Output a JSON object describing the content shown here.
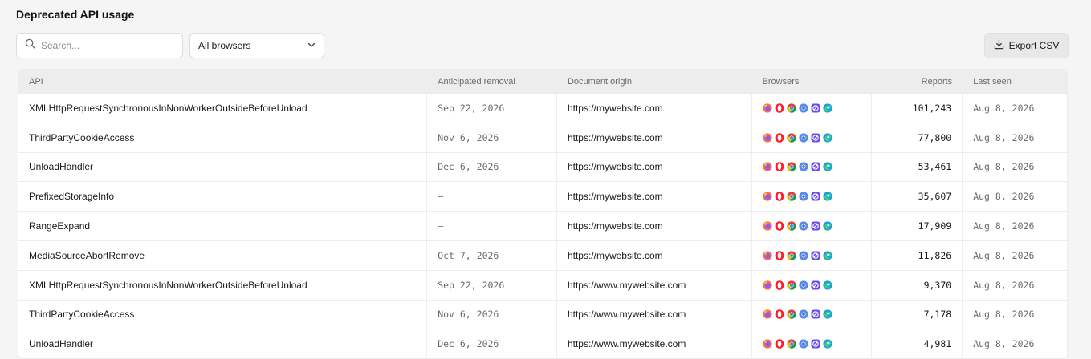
{
  "page": {
    "title": "Deprecated API usage"
  },
  "toolbar": {
    "search_placeholder": "Search...",
    "browser_filter": "All browsers",
    "export_label": "Export CSV"
  },
  "table": {
    "headers": {
      "api": "API",
      "removal": "Anticipated removal",
      "origin": "Document origin",
      "browsers": "Browsers",
      "reports": "Reports",
      "last_seen": "Last seen"
    },
    "browser_icons": [
      "firefox-icon",
      "opera-icon",
      "chrome-icon",
      "chromium-icon",
      "brave-icon",
      "edge-icon"
    ],
    "rows": [
      {
        "api": "XMLHttpRequestSynchronousInNonWorkerOutsideBeforeUnload",
        "removal": "Sep 22, 2026",
        "origin": "https://mywebsite.com",
        "reports": "101,243",
        "last_seen": "Aug 8, 2026"
      },
      {
        "api": "ThirdPartyCookieAccess",
        "removal": "Nov 6, 2026",
        "origin": "https://mywebsite.com",
        "reports": "77,800",
        "last_seen": "Aug 8, 2026"
      },
      {
        "api": "UnloadHandler",
        "removal": "Dec 6, 2026",
        "origin": "https://mywebsite.com",
        "reports": "53,461",
        "last_seen": "Aug 8, 2026"
      },
      {
        "api": "PrefixedStorageInfo",
        "removal": "—",
        "origin": "https://mywebsite.com",
        "reports": "35,607",
        "last_seen": "Aug 8, 2026"
      },
      {
        "api": "RangeExpand",
        "removal": "—",
        "origin": "https://mywebsite.com",
        "reports": "17,909",
        "last_seen": "Aug 8, 2026"
      },
      {
        "api": "MediaSourceAbortRemove",
        "removal": "Oct 7, 2026",
        "origin": "https://mywebsite.com",
        "reports": "11,826",
        "last_seen": "Aug 8, 2026"
      },
      {
        "api": "XMLHttpRequestSynchronousInNonWorkerOutsideBeforeUnload",
        "removal": "Sep 22, 2026",
        "origin": "https://www.mywebsite.com",
        "reports": "9,370",
        "last_seen": "Aug 8, 2026"
      },
      {
        "api": "ThirdPartyCookieAccess",
        "removal": "Nov 6, 2026",
        "origin": "https://www.mywebsite.com",
        "reports": "7,178",
        "last_seen": "Aug 8, 2026"
      },
      {
        "api": "UnloadHandler",
        "removal": "Dec 6, 2026",
        "origin": "https://www.mywebsite.com",
        "reports": "4,981",
        "last_seen": "Aug 8, 2026"
      }
    ]
  },
  "colors": {
    "background": "#f5f5f5",
    "header_bg": "#ededed",
    "muted_text": "#6b6b6b"
  }
}
